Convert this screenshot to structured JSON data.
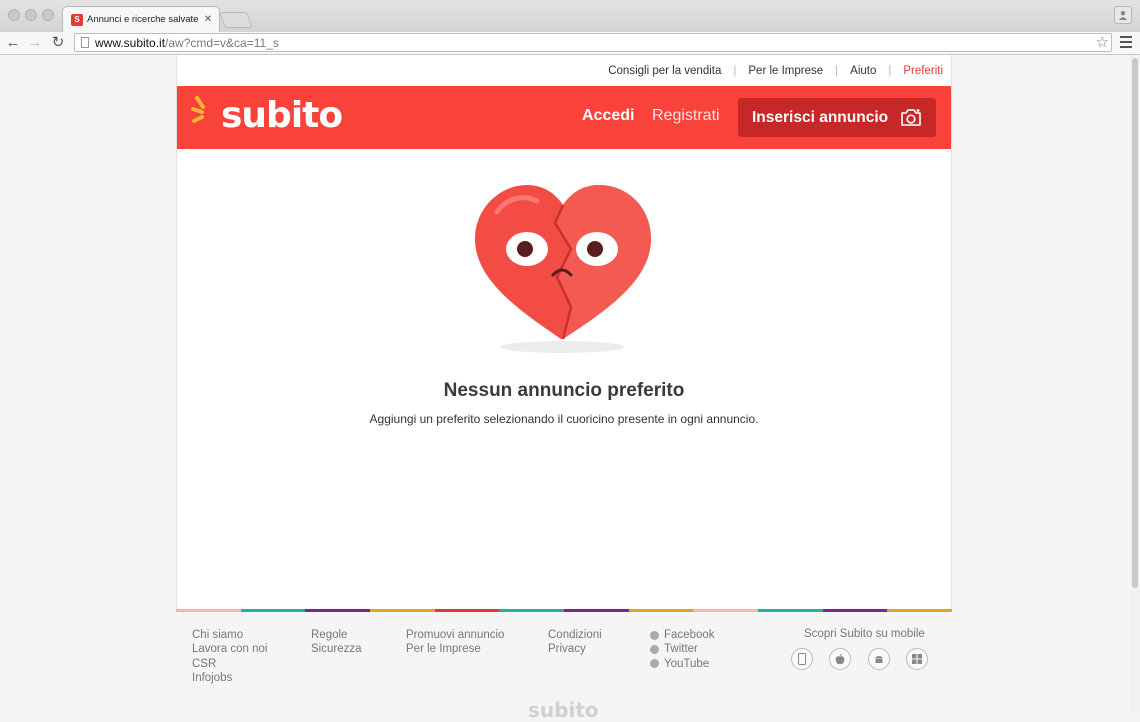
{
  "browser": {
    "tab_title": "Annunci e ricerche salvate",
    "url_host": "www.subito.it",
    "url_path": "/aw?cmd=v&ca=11_s"
  },
  "toplinks": [
    {
      "label": "Consigli per la vendita",
      "active": false
    },
    {
      "label": "Per le Imprese",
      "active": false
    },
    {
      "label": "Aiuto",
      "active": false
    },
    {
      "label": "Preferiti",
      "active": true
    }
  ],
  "header": {
    "logo": "subito",
    "login_label": "Accedi",
    "register_label": "Registrati",
    "post_ad_label": "Inserisci annuncio"
  },
  "empty_state": {
    "title": "Nessun annuncio preferito",
    "subtitle": "Aggiungi un preferito selezionando il cuoricino presente in ogni annuncio."
  },
  "footer": {
    "col1": [
      "Chi siamo",
      "Lavora con noi",
      "CSR",
      "Infojobs"
    ],
    "col2": [
      "Regole",
      "Sicurezza"
    ],
    "col3": [
      "Promuovi annuncio",
      "Per le Imprese"
    ],
    "col4": [
      "Condizioni",
      "Privacy"
    ],
    "social": [
      "Facebook",
      "Twitter",
      "YouTube"
    ],
    "mobile_title": "Scopri Subito su mobile",
    "footer_logo": "subito"
  },
  "colors": {
    "brand_red": "#f9423a",
    "button_dark_red": "#c62828",
    "footer_stripe": [
      "#f7b5ac",
      "#26b0a3",
      "#7b2391",
      "#e8a21b",
      "#e53935",
      "#26b0a3",
      "#7b2391",
      "#e8a21b",
      "#f7b5ac",
      "#26b0a3",
      "#7b2391",
      "#e8a21b"
    ]
  }
}
